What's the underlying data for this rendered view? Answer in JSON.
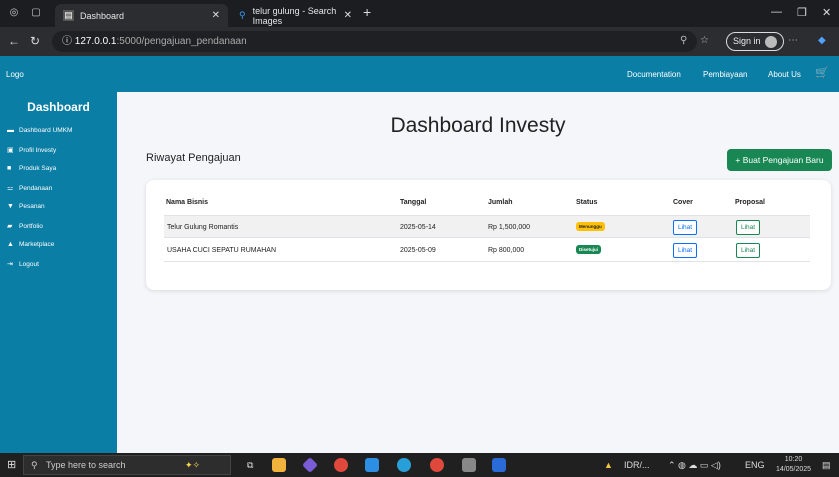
{
  "browser": {
    "active_tab": "Dashboard",
    "inactive_tab": "telur gulung - Search Images",
    "new_tab_label": "+",
    "url_host": "127.0.0.1",
    "url_path": ":5000/pengajuan_pendanaan",
    "signin_label": "Sign in"
  },
  "navbar": {
    "logo": "Logo",
    "links": [
      "Documentation",
      "Pembiayaan",
      "About Us"
    ]
  },
  "sidebar": {
    "title": "Dashboard",
    "items": [
      {
        "label": "Dashboard UMKM",
        "icon": "dashboard-icon"
      },
      {
        "label": "Profil Investy",
        "icon": "id-card-icon"
      },
      {
        "label": "Produk Saya",
        "icon": "box-icon"
      },
      {
        "label": "Pendanaan",
        "icon": "handshake-icon"
      },
      {
        "label": "Pesanan",
        "icon": "cart-icon"
      },
      {
        "label": "Portfolio",
        "icon": "briefcase-icon"
      },
      {
        "label": "Marketplace",
        "icon": "store-icon"
      },
      {
        "label": "Logout",
        "icon": "logout-icon"
      }
    ]
  },
  "main": {
    "title": "Dashboard Investy",
    "subtitle": "Riwayat Pengajuan",
    "new_button": "+ Buat Pengajuan Baru",
    "table": {
      "headers": [
        "Nama Bisnis",
        "Tanggal",
        "Jumlah",
        "Status",
        "Cover",
        "Proposal"
      ],
      "rows": [
        {
          "nama": "Telur Gulung Romantis",
          "tanggal": "2025-05-14",
          "jumlah": "Rp 1,500,000",
          "status": "Menunggu",
          "cover": "Lihat",
          "proposal": "Lihat"
        },
        {
          "nama": "USAHA CUCI SEPATU RUMAHAN",
          "tanggal": "2025-05-09",
          "jumlah": "Rp 800,000",
          "status": "Disetujui",
          "cover": "Lihat",
          "proposal": "Lihat"
        }
      ]
    }
  },
  "taskbar": {
    "search_placeholder": "Type here to search",
    "ticker": "IDR/...",
    "lang": "ENG",
    "time": "10:20",
    "date": "14/05/2025"
  },
  "colors": {
    "primary": "#0a7ea4",
    "success": "#198754",
    "warning": "#ffc107"
  }
}
